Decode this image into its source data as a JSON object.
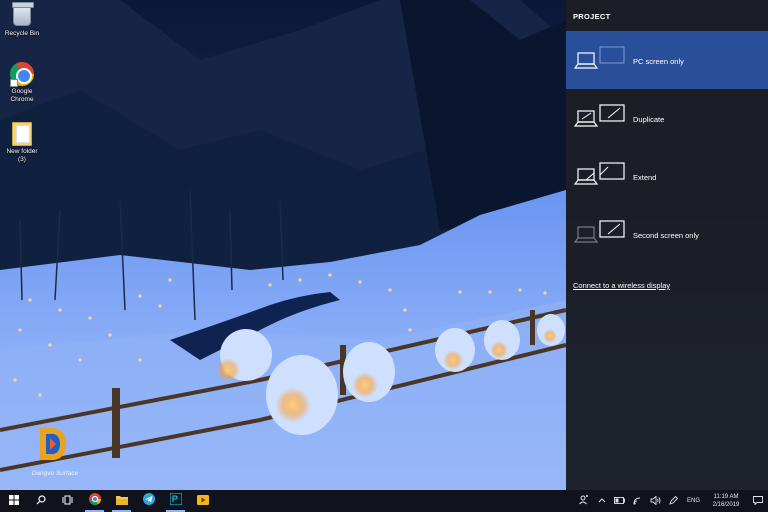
{
  "desktop": {
    "icons": [
      {
        "label": "Recycle Bin",
        "icon": "recycle-bin-icon"
      },
      {
        "label": "Google Chrome",
        "icon": "chrome-icon"
      },
      {
        "label": "New folder (3)",
        "icon": "folder-icon"
      }
    ],
    "watermark": "Dangvu Surface"
  },
  "project_panel": {
    "title": "PROJECT",
    "options": [
      {
        "label": "PC screen only",
        "icon": "pc-screen-only-icon",
        "selected": true
      },
      {
        "label": "Duplicate",
        "icon": "duplicate-icon",
        "selected": false
      },
      {
        "label": "Extend",
        "icon": "extend-icon",
        "selected": false
      },
      {
        "label": "Second screen only",
        "icon": "second-screen-only-icon",
        "selected": false
      }
    ],
    "connect_link": "Connect to a wireless display",
    "selected_color": "#2a4f9a"
  },
  "taskbar": {
    "apps": [
      "start-icon",
      "search-icon",
      "task-view-icon",
      "chrome-icon",
      "file-explorer-icon",
      "telegram-icon",
      "photoshop-icon",
      "media-player-icon"
    ],
    "tray": {
      "language": "ENG",
      "time": "11:19 AM",
      "date": "2/16/2019"
    }
  }
}
